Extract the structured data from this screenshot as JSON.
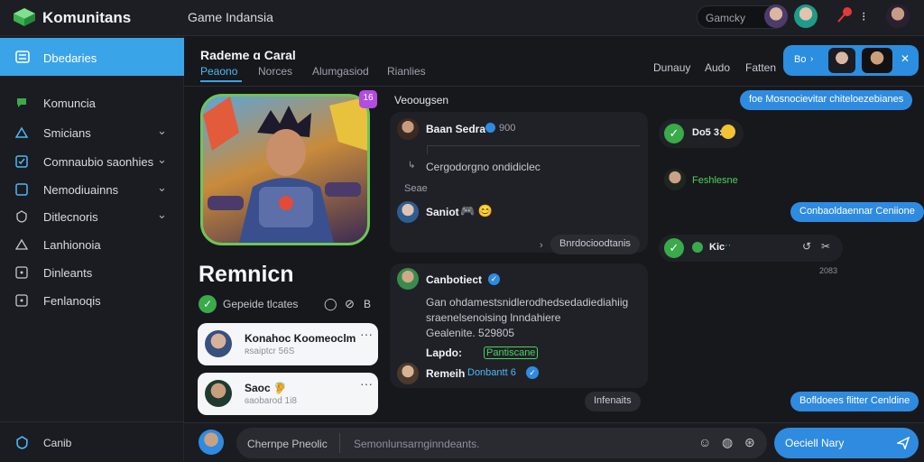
{
  "topbar": {
    "app_title": "Komunitans",
    "game_title": "Game Indansia",
    "search_placeholder": "Gamcky"
  },
  "sidebar": {
    "items": [
      {
        "label": "Dbedaries",
        "icon": "document-icon"
      },
      {
        "label": "Komuncia",
        "icon": "chat-icon"
      },
      {
        "label": "Smicians",
        "icon": "triangle-icon"
      },
      {
        "label": "Comnaubio saonhies",
        "icon": "checkbox-icon"
      },
      {
        "label": "Nemodiuainns",
        "icon": "square-icon"
      },
      {
        "label": "Ditlecnoris",
        "icon": "shield-icon"
      },
      {
        "label": "Lanhionoia",
        "icon": "triangle-icon"
      },
      {
        "label": "Dinleants",
        "icon": "window-icon"
      },
      {
        "label": "Fenlanoqis",
        "icon": "window-icon"
      }
    ],
    "bottom_label": "Canib"
  },
  "main": {
    "title": "Rademe ɑ Caral",
    "tabs": [
      "Peaono",
      "Norces",
      "Alumgasiod",
      "Rianlies"
    ],
    "right_tabs": [
      "Dunauy",
      "Audo",
      "Fatten"
    ],
    "pill_label": "Bo"
  },
  "hero": {
    "badge": "16",
    "name": "Remnicn",
    "status": "Gepeide tlcates",
    "action_extra": "B"
  },
  "friends": [
    {
      "name": "Konahoc Koomeoclm",
      "status": "ʀsaiptcr 56S"
    },
    {
      "name": "Saoc 🦻",
      "status": "ɞaobarod 1i8"
    }
  ],
  "chat": {
    "section_title": "Veoougsen",
    "messages": [
      {
        "name": "Baan Sedra",
        "count": "900",
        "text": "Cergodorgno ondidiclec",
        "meta": "Seae"
      },
      {
        "name": "Saniot",
        "text": "🎮 😊"
      },
      {
        "name": "Canbotiect",
        "line1": "Gan ohdamestsnidlerodhedsedadiediahiig",
        "line2": "sraenelsenoising lnndahiere",
        "line3": "Gealenite. 529805",
        "reply1": "Lapdo:",
        "reply1_tag": "Pantiscane",
        "reply2": "Remeih",
        "reply2_tag": "Donbantt 6"
      }
    ],
    "pill_1": "Bnrdocioodtanis",
    "pill_2": "Infenaits"
  },
  "right_chat": {
    "bubble_1": "foe Mosnocievitar chiteloezebianes",
    "user_1": "Do5 3:",
    "user_2": "Feshlesne",
    "bubble_2": "Conbaoldaennar Ceniione",
    "user_3": "Kic",
    "time": "2083",
    "bubble_3": "Bofldoees flitter Cenldine"
  },
  "input": {
    "label": "Chernpe Pneolic",
    "placeholder": "Semonlunsarnginndeants.",
    "send_label": "Oeciell Nary"
  },
  "colors": {
    "accent": "#2f8be0",
    "sidebar_active": "#3aa4e8",
    "online_green": "#3aaa4a",
    "hero_border": "#6dc557"
  }
}
